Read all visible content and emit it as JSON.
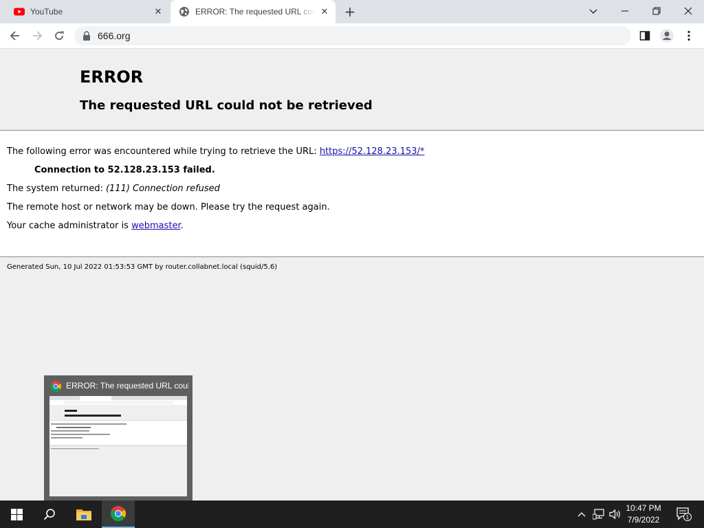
{
  "browser": {
    "tabs": [
      {
        "title": "YouTube"
      },
      {
        "title": "ERROR: The requested URL could not be retrieved"
      }
    ],
    "url": "666.org"
  },
  "page": {
    "heading": "ERROR",
    "subheading": "The requested URL could not be retrieved",
    "line1_prefix": "The following error was encountered while trying to retrieve the URL:",
    "line1_link": "https://52.128.23.153/*",
    "connection": "Connection to 52.128.23.153 failed.",
    "system_prefix": "The system returned:",
    "system_value": "(111) Connection refused",
    "remote": "The remote host or network may be down. Please try the request again.",
    "cache_prefix": "Your cache administrator is",
    "cache_link": "webmaster",
    "cache_suffix": ".",
    "footer": "Generated Sun, 10 Jul 2022 01:53:53 GMT by router.collabnet.local (squid/5.6)"
  },
  "thumbnail": {
    "title": "ERROR: The requested URL coul..."
  },
  "taskbar": {
    "time": "10:47 PM",
    "date": "7/9/2022",
    "notification_count": "1"
  },
  "colors": {
    "link": "#1a0dab",
    "youtube_red": "#ff0000",
    "taskbar": "#1f1f1f"
  }
}
